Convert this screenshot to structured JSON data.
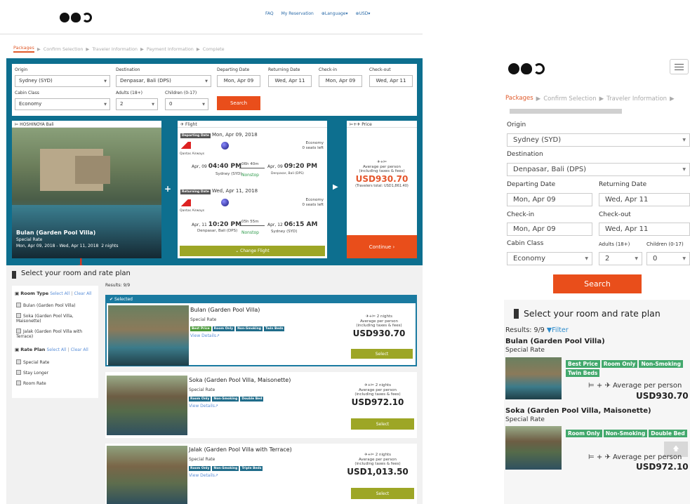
{
  "nav": {
    "faq": "FAQ",
    "reservation": "My Reservation",
    "language": "Language",
    "currency": "USD"
  },
  "steps": [
    "Packages",
    "Confirm Selection",
    "Traveler Information",
    "Payment Information",
    "Complete"
  ],
  "search": {
    "origin_label": "Origin",
    "origin": "Sydney (SYD)",
    "destination_label": "Destination",
    "destination": "Denpasar, Bali (DPS)",
    "departing_label": "Departing Date",
    "departing": "Mon, Apr 09",
    "returning_label": "Returning Date",
    "returning": "Wed, Apr 11",
    "checkin_label": "Check-in",
    "checkin": "Mon, Apr 09",
    "checkout_label": "Check-out",
    "checkout": "Wed, Apr 11",
    "cabin_label": "Cabin Class",
    "cabin": "Economy",
    "adults_label": "Adults (18+)",
    "adults": "2",
    "children_label": "Children (0-17)",
    "children": "0",
    "search_button": "Search"
  },
  "hotel": {
    "name": "HOSHINOYA Bali",
    "room": "Bulan (Garden Pool Villa)",
    "rate": "Special Rate",
    "dates": "Mon, Apr 09, 2018 - Wed, Apr 11, 2018",
    "nights": "2 nights"
  },
  "flight": {
    "header": "Flight",
    "depart_tag": "Departing Date",
    "depart_date": "Mon, Apr 09, 2018",
    "airline": "Qantas Airways",
    "class": "Economy",
    "seats": "0 seats left",
    "out_day": "Apr, 09",
    "out_time": "04:40 PM",
    "out_from": "Sydney (SYD)",
    "out_dur": "06h 40m",
    "out_stop": "Nonstop",
    "out_arr_day": "Apr, 09",
    "out_arr_time": "09:20 PM",
    "out_to": "Denpasar, Bali (DPS)",
    "return_tag": "Returning Date",
    "return_date": "Wed, Apr 11, 2018",
    "airline2": "Qantas Airways",
    "class2": "Economy",
    "seats2": "0 seats left",
    "in_day": "Apr, 11",
    "in_time": "10:20 PM",
    "in_from": "Denpasar, Bali (DPS)",
    "in_dur": "05h 55m",
    "in_stop": "Nonstop",
    "in_arr_day": "Apr, 12",
    "in_arr_time": "06:15 AM",
    "in_to": "Sydney (SYD)",
    "change": "Change Flight"
  },
  "pricebox": {
    "header": "Price",
    "avg": "Average per person",
    "incl": "(including taxes & fees)",
    "price": "USD930.70",
    "total": "(Travelers total: USD1,861.40)",
    "continue": "Continue"
  },
  "rooms_section": {
    "title": "Select your room and rate plan",
    "results": "Results: 9/9",
    "filter": "Filter"
  },
  "filters": {
    "room_type": "Room Type",
    "select_all": "Select All",
    "clear_all": "Clear All",
    "room_types": [
      "Bulan (Garden Pool Villa)",
      "Soka (Garden Pool Villa, Maisonette)",
      "Jalak (Garden Pool Villa with Terrace)"
    ],
    "rate_plan": "Rate Plan",
    "select_all2": "Select All",
    "clear_all2": "Clear All",
    "rate_plans": [
      "Special Rate",
      "Stay Longer",
      "Room Rate"
    ]
  },
  "selected_label": "Selected",
  "rooms": [
    {
      "name": "Bulan (Garden Pool Villa)",
      "rate": "Special Rate",
      "badges": [
        "Best Price",
        "Room Only",
        "Non-Smoking",
        "Twin Beds"
      ],
      "details": "View Details",
      "nights": "2 nights",
      "avg": "Average per person",
      "incl": "(including taxes & fees)",
      "price": "USD930.70",
      "select": "Select"
    },
    {
      "name": "Soka (Garden Pool Villa, Maisonette)",
      "rate": "Special Rate",
      "badges": [
        "Room Only",
        "Non-Smoking",
        "Double Bed"
      ],
      "details": "View Details",
      "nights": "2 nights",
      "avg": "Average per person",
      "incl": "(including taxes & fees)",
      "price": "USD972.10",
      "select": "Select"
    },
    {
      "name": "Jalak (Garden Pool Villa with Terrace)",
      "rate": "Special Rate",
      "badges": [
        "Room Only",
        "Non-Smoking",
        "Triple Beds"
      ],
      "details": "View Details",
      "nights": "2 nights",
      "avg": "Average per person",
      "incl": "(including taxes & fees)",
      "price": "USD1,013.50",
      "select": "Select"
    }
  ],
  "mobile": {
    "steps": [
      "Packages",
      "Confirm Selection",
      "Traveler Information"
    ],
    "avg": "Average per person",
    "rooms": [
      {
        "name": "Bulan (Garden Pool Villa)",
        "rate": "Special Rate",
        "badges": [
          "Best Price",
          "Room Only",
          "Non-Smoking",
          "Twin Beds"
        ],
        "price": "USD930.70"
      },
      {
        "name": "Soka (Garden Pool Villa, Maisonette)",
        "rate": "Special Rate",
        "badges": [
          "Room Only",
          "Non-Smoking",
          "Double Bed"
        ],
        "price": "USD972.10"
      }
    ]
  },
  "colors": {
    "accent": "#e94e1b",
    "brand_blue": "#0d6f8f",
    "olive": "#9da626",
    "price": "#e5562c"
  }
}
